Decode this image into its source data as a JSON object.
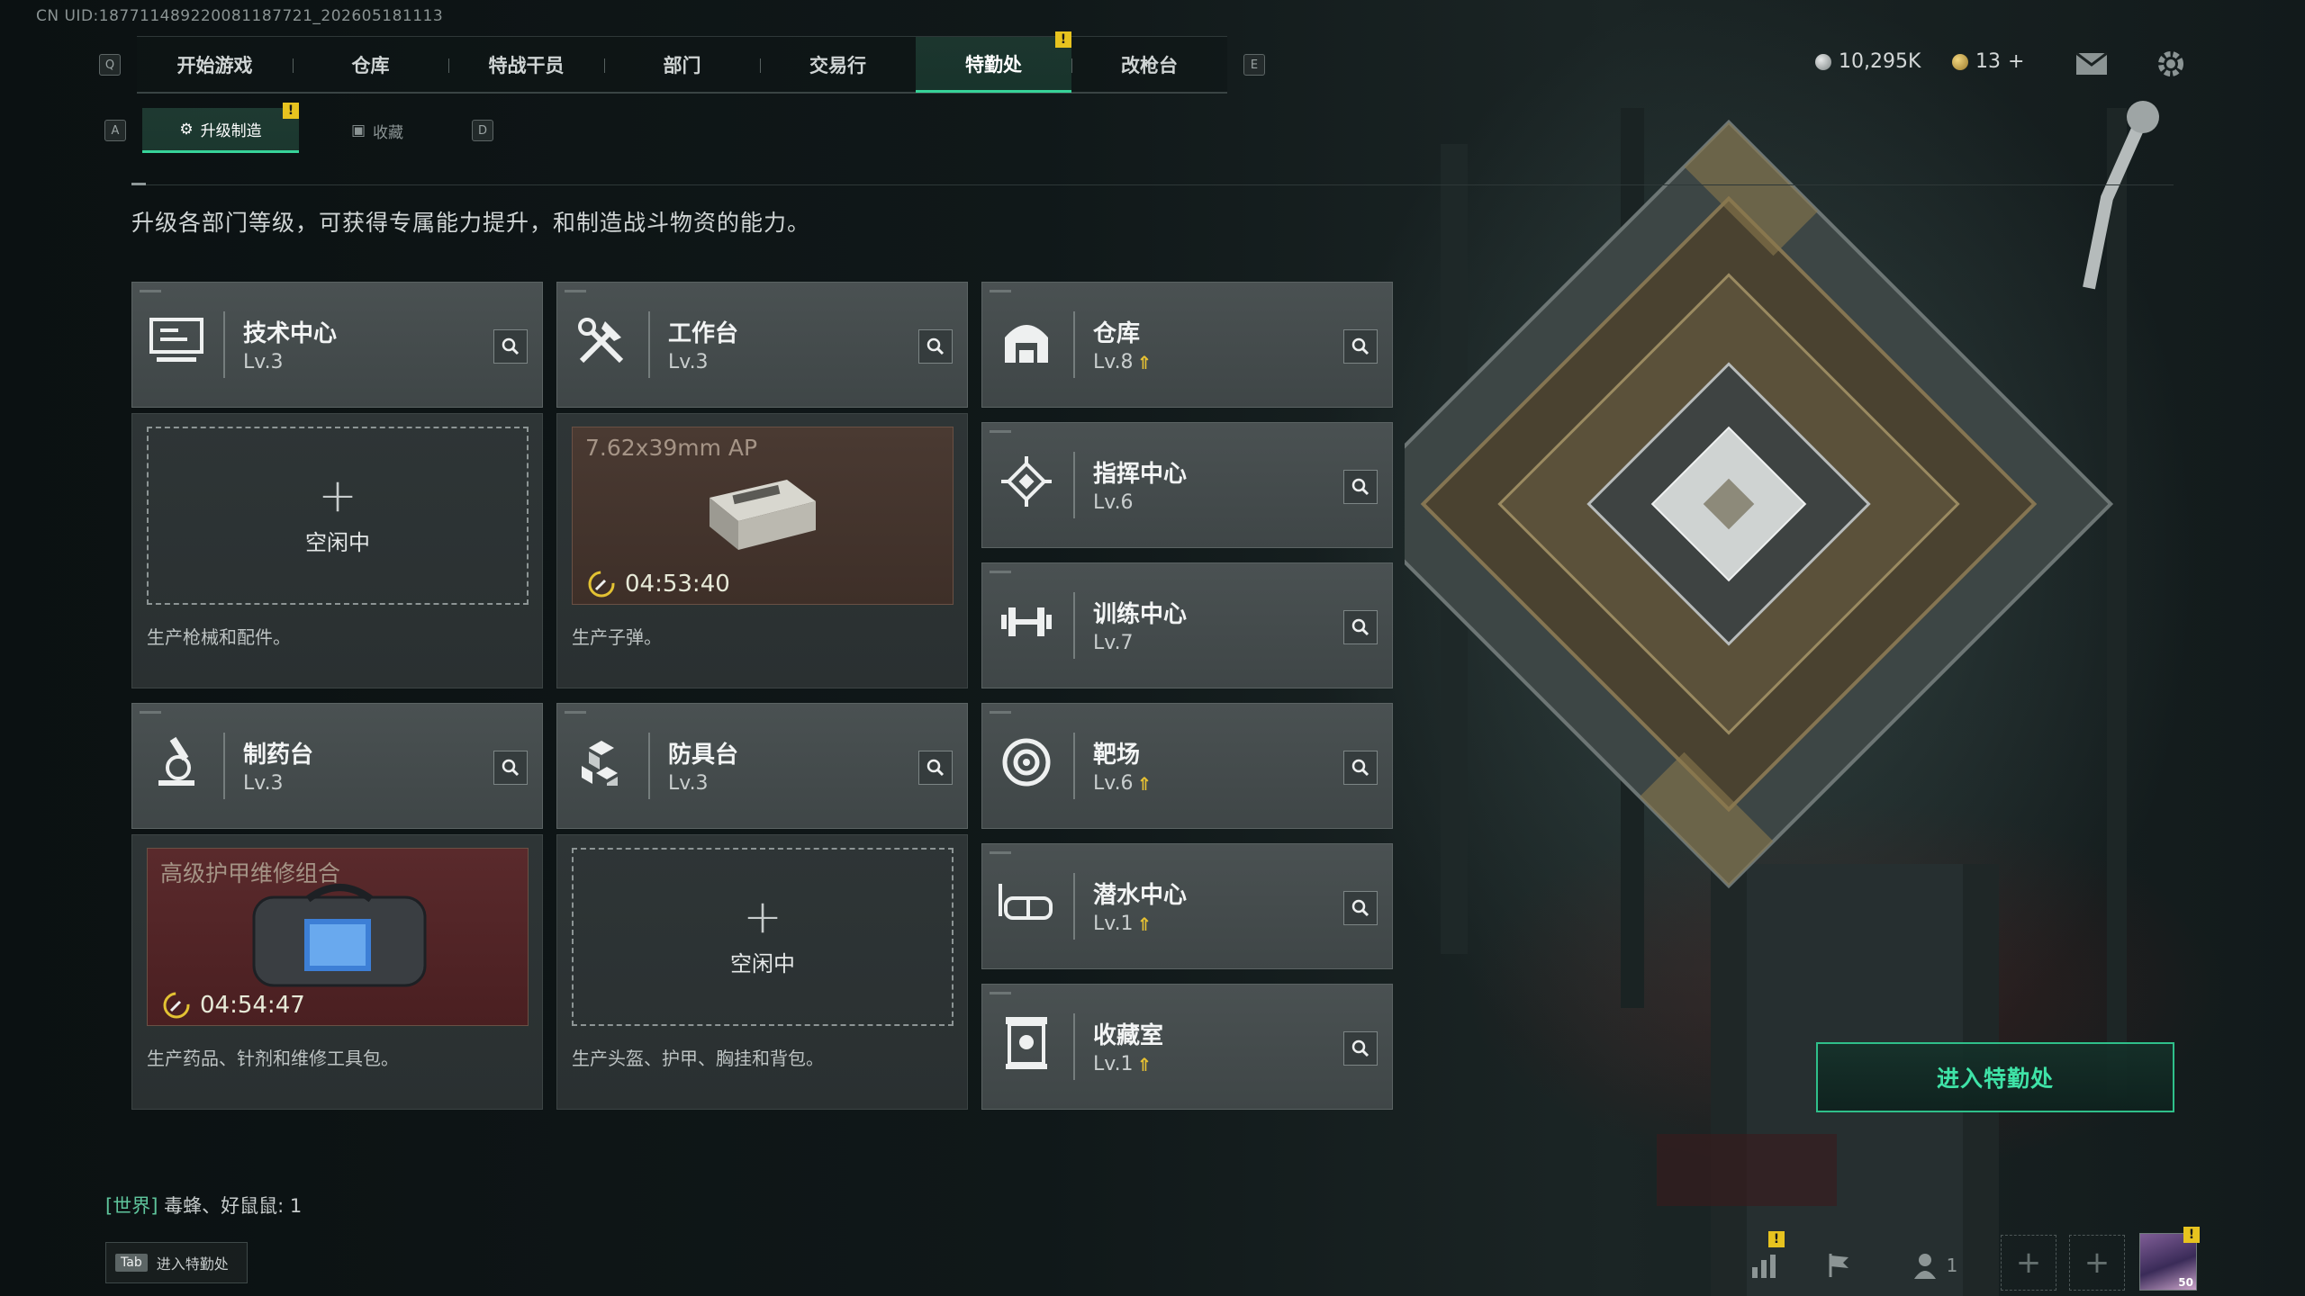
{
  "uid_text": "CN UID:18771148922008118772​1_202605181113",
  "nav": {
    "left_key": "Q",
    "right_key": "E",
    "tabs": [
      "开始游戏",
      "仓库",
      "特战干员",
      "部门",
      "交易行",
      "特勤处",
      "改枪台"
    ],
    "active_tab": "特勤处"
  },
  "currency": {
    "coins": "10,295K",
    "premium": "13",
    "premium_add": "+"
  },
  "subnav": {
    "left_key": "A",
    "right_key": "D",
    "tabs": [
      "升级制造",
      "收藏"
    ],
    "active_tab": "升级制造"
  },
  "description": "升级各部门等级，可获得专属能力提升，和制造战斗物资的能力。",
  "facilities": {
    "tech_center": {
      "name": "技术中心",
      "level": "Lv.3",
      "slot": "空闲中",
      "footer": "生产枪械和配件。"
    },
    "workbench": {
      "name": "工作台",
      "level": "Lv.3",
      "item": "7.62x39mm AP",
      "timer": "04:53:40",
      "footer": "生产子弹。"
    },
    "pharmacy": {
      "name": "制药台",
      "level": "Lv.3",
      "item": "高级护甲维修组合",
      "timer": "04:54:47",
      "footer": "生产药品、针剂和维修工具包。"
    },
    "armor_bench": {
      "name": "防具台",
      "level": "Lv.3",
      "slot": "空闲中",
      "footer": "生产头盔、护甲、胸挂和背包。"
    },
    "warehouse": {
      "name": "仓库",
      "level": "Lv.8"
    },
    "command_center": {
      "name": "指挥中心",
      "level": "Lv.6"
    },
    "training_center": {
      "name": "训练中心",
      "level": "Lv.7"
    },
    "range": {
      "name": "靶场",
      "level": "Lv.6"
    },
    "diving_center": {
      "name": "潜水中心",
      "level": "Lv.1"
    },
    "collection_room": {
      "name": "收藏室",
      "level": "Lv.1"
    }
  },
  "enter_button": "进入特勤处",
  "chat": {
    "channel": "[世界]",
    "text": " 毒蜂、好鼠鼠: 1"
  },
  "tab_hint": {
    "key": "Tab",
    "label": "进入特勤处"
  },
  "bottom": {
    "friends_count": "1",
    "avatar_level": "50"
  },
  "colors": {
    "accent": "#37d399",
    "warning": "#e7c31f",
    "upgrade_arrow": "#e8c233"
  }
}
